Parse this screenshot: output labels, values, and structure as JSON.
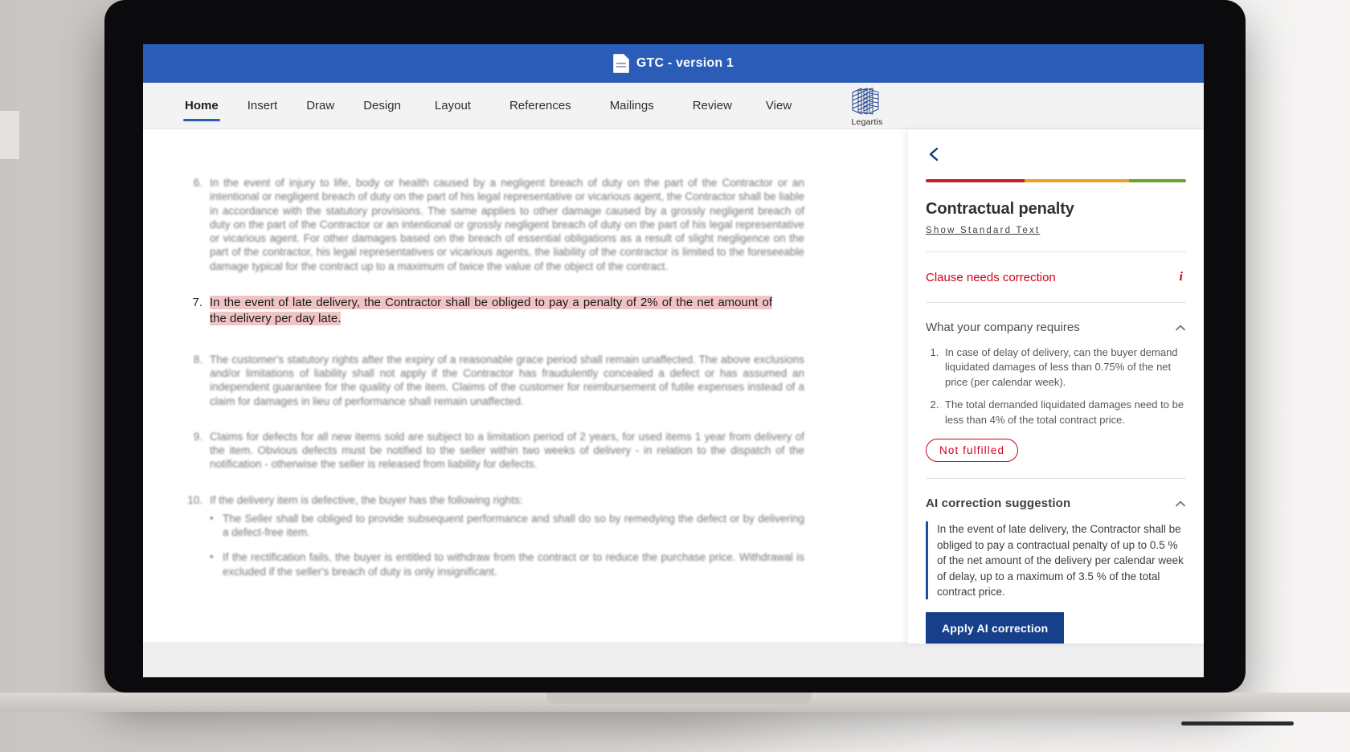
{
  "titlebar": {
    "doc_title": "GTC - version 1",
    "icon": "document-icon"
  },
  "ribbon": {
    "tabs": [
      {
        "label": "Home",
        "active": true
      },
      {
        "label": "Insert",
        "active": false
      },
      {
        "label": "Draw",
        "active": false
      },
      {
        "label": "Design",
        "active": false
      },
      {
        "label": "Layout",
        "active": false
      },
      {
        "label": "References",
        "active": false
      },
      {
        "label": "Mailings",
        "active": false
      },
      {
        "label": "Review",
        "active": false
      },
      {
        "label": "View",
        "active": false
      }
    ],
    "brand_name": "Legartis"
  },
  "document": {
    "paragraphs": [
      {
        "number": "6.",
        "text": "In the event of injury to life, body or health caused by a  negligent breach of duty on the part of the Contractor or an intentional or negligent  breach of duty on the part of his legal representative or vicarious agent, the  Contractor shall be liable in accordance with the statutory provisions. The same applies to other damage caused by a grossly negligent breach of duty on the part of the Contractor or an intentional or grossly negligent breach of duty on the part of his legal representative or vicarious agent. For other damages based on the  breach of essential obligations as a result of slight negligence on the part  of the contractor, his legal representatives or vicarious agents, the  liability of the contractor is limited to the foreseeable damage typical for  the contract up to a maximum of twice the value of the object of the contract."
      },
      {
        "number": "7.",
        "highlighted": true,
        "text": "In the event of late delivery, the Contractor shall be obliged to pay a penalty of 2% of the net amount of the delivery per day late."
      },
      {
        "number": "8.",
        "text": "The customer's statutory rights after the expiry of a reasonable grace period shall remain unaffected. The above exclusions and/or limitations of liability shall not apply if the Contractor has fraudulently concealed a defect or has assumed an independent guarantee for the quality of the item. Claims of the customer for reimbursement of futile expenses instead of a claim for damages in lieu of performance shall remain unaffected."
      },
      {
        "number": "9.",
        "text": "Claims for defects for all new items sold are subject to a limitation period of 2 years, for used items 1 year from delivery of the item. Obvious defects must be notified to the seller within two  weeks of delivery - in relation to the dispatch of the notification -  otherwise the seller is released from liability for defects."
      },
      {
        "number": "10.",
        "text": "If the delivery item is defective, the buyer has the following rights:",
        "bullets": [
          "The Seller shall be obliged to provide subsequent performance and shall do so by remedying the defect or by delivering a defect-free item.",
          "If the rectification fails, the buyer is entitled to withdraw from the contract or to reduce the purchase price. Withdrawal is excluded if the seller's breach of duty is only insignificant."
        ]
      }
    ]
  },
  "panel": {
    "back_icon": "chevron-left-icon",
    "score_segments": [
      {
        "color": "#c4202b",
        "width_pct": 38
      },
      {
        "color": "#eca126",
        "width_pct": 40
      },
      {
        "color": "#6fa22a",
        "width_pct": 22
      }
    ],
    "title": "Contractual penalty",
    "standard_text_link": "Show Standard Text",
    "status": "Clause needs correction",
    "status_color": "#d0021b",
    "info_icon": "info-icon",
    "requirements_section": {
      "heading": "What your company requires",
      "collapse_icon": "chevron-up-icon",
      "items": [
        "In case of delay of delivery, can the buyer demand liquidated damages of less than 0.75% of the net price (per calendar week).",
        "The total demanded liquidated damages need to be less than 4% of the total contract price."
      ],
      "badge": "Not fulfilled",
      "badge_color": "#d0021b"
    },
    "ai_section": {
      "heading": "AI correction suggestion",
      "collapse_icon": "chevron-up-icon",
      "suggestion": "In the event of late delivery, the Contractor shall be obliged to pay a contractual penalty of up to 0.5 % of the net amount of the delivery per calendar week of delay, up to a maximum of 3.5 % of the total contract price.",
      "apply_button": "Apply AI correction",
      "apply_button_color": "#17408b"
    }
  }
}
